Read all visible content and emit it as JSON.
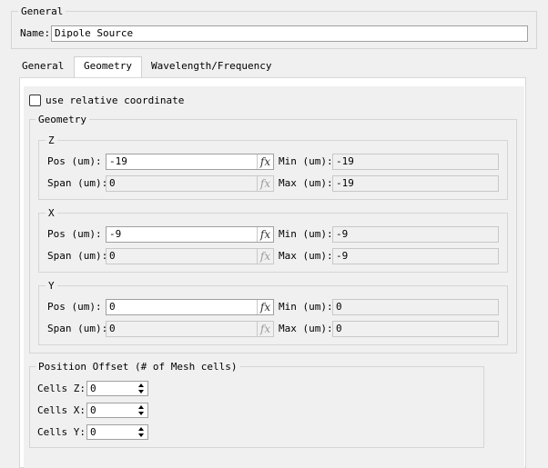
{
  "general_group": {
    "title": "General",
    "name_label": "Name:",
    "name_value": "Dipole Source"
  },
  "tabs": [
    {
      "label": "General",
      "active": false
    },
    {
      "label": "Geometry",
      "active": true
    },
    {
      "label": "Wavelength/Frequency",
      "active": false
    }
  ],
  "geometry_tab": {
    "relative_checkbox_label": "use relative coordinate",
    "relative_checked": false,
    "geometry_group_title": "Geometry",
    "pos_label": "Pos (um):",
    "span_label": "Span (um):",
    "min_label": "Min (um):",
    "max_label": "Max (um):",
    "fx_symbol": "fx",
    "axes": [
      {
        "title": "Z",
        "pos": "-19",
        "span": "0",
        "min": "-19",
        "max": "-19"
      },
      {
        "title": "X",
        "pos": "-9",
        "span": "0",
        "min": "-9",
        "max": "-9"
      },
      {
        "title": "Y",
        "pos": "0",
        "span": "0",
        "min": "0",
        "max": "0"
      }
    ],
    "offset_group_title": "Position Offset (# of Mesh cells)",
    "cells": [
      {
        "label": "Cells Z:",
        "value": "0"
      },
      {
        "label": "Cells X:",
        "value": "0"
      },
      {
        "label": "Cells Y:",
        "value": "0"
      }
    ]
  }
}
